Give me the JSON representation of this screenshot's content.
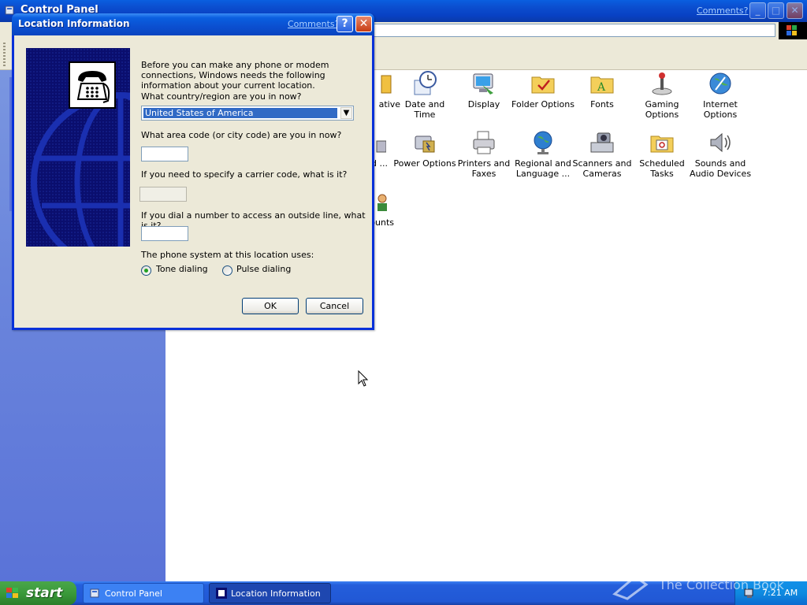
{
  "control_panel": {
    "title": "Control Panel",
    "comments_link": "Comments?",
    "buttons": {
      "minimize": "_",
      "maximize": "□",
      "close": "✕"
    },
    "items": [
      {
        "name": "administrative-tools",
        "label": "ative",
        "icon": "folder-tools-icon"
      },
      {
        "name": "date-and-time",
        "label": "Date and Time",
        "icon": "clock-calendar-icon"
      },
      {
        "name": "display",
        "label": "Display",
        "icon": "monitor-icon"
      },
      {
        "name": "folder-options",
        "label": "Folder Options",
        "icon": "folder-check-icon"
      },
      {
        "name": "fonts",
        "label": "Fonts",
        "icon": "fonts-folder-icon"
      },
      {
        "name": "gaming-options",
        "label": "Gaming Options",
        "icon": "joystick-icon"
      },
      {
        "name": "internet-options",
        "label": "Internet Options",
        "icon": "globe-icon"
      },
      {
        "name": "phone-and-modem",
        "label": "and ...",
        "icon": "phone-icon"
      },
      {
        "name": "power-options",
        "label": "Power Options",
        "icon": "power-icon"
      },
      {
        "name": "printers-and-faxes",
        "label": "Printers and Faxes",
        "icon": "printer-icon"
      },
      {
        "name": "regional-and-language",
        "label": "Regional and Language ...",
        "icon": "globe-stand-icon"
      },
      {
        "name": "scanners-and-cameras",
        "label": "Scanners and Cameras",
        "icon": "scanner-icon"
      },
      {
        "name": "scheduled-tasks",
        "label": "Scheduled Tasks",
        "icon": "calendar-folder-icon"
      },
      {
        "name": "sounds-and-audio",
        "label": "Sounds and Audio Devices",
        "icon": "speaker-icon"
      },
      {
        "name": "user-accounts",
        "label": "ounts",
        "icon": "users-icon"
      }
    ]
  },
  "dialog": {
    "title": "Location Information",
    "comments_link": "Comments?",
    "help_button": "?",
    "close_button": "✕",
    "intro": "Before you can make any phone or modem connections, Windows needs the following information about your current location.",
    "country_question": "What country/region are you in now?",
    "country_value": "United States of America",
    "area_question": "What area code (or city code) are you in now?",
    "area_value": "",
    "carrier_question": "If you need to specify a carrier code, what is it?",
    "carrier_value": "",
    "outside_question": "If you dial a number to access an outside line, what is it?",
    "outside_value": "",
    "phone_system_question": "The phone system at this location uses:",
    "tone_label": "Tone dialing",
    "pulse_label": "Pulse dialing",
    "selected_dialing": "tone",
    "ok_label": "OK",
    "cancel_label": "Cancel"
  },
  "taskbar": {
    "start_label": "start",
    "tasks": [
      {
        "label": "Control Panel",
        "active": false
      },
      {
        "label": "Location Information",
        "active": true
      }
    ],
    "clock": "7:21 AM"
  },
  "watermark": "The Collection Book",
  "colors": {
    "title_blue": "#0a5fe0",
    "dialog_face": "#ece9d8",
    "selection_blue": "#316ac5",
    "start_green": "#3a9a3a",
    "tray_blue": "#0f8ae0"
  }
}
